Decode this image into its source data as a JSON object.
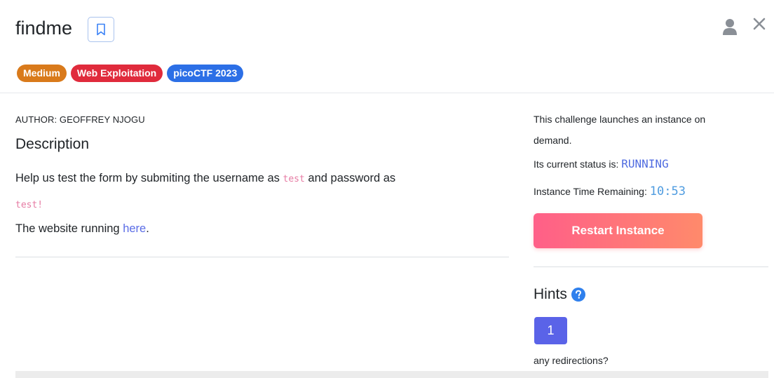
{
  "challenge": {
    "title": "findme",
    "tags": [
      "Medium",
      "Web Exploitation",
      "picoCTF 2023"
    ],
    "author": "AUTHOR: GEOFFREY NJOGU",
    "description_heading": "Description",
    "description": {
      "line1_before": "Help us test the form by submiting the username as ",
      "username": "test",
      "line1_middle": " and password as",
      "password": "test!",
      "line3_before": "The website running ",
      "link_text": "here",
      "line3_after": "."
    }
  },
  "instance": {
    "launch_line1": "This challenge launches an instance on",
    "launch_line2": "demand.",
    "status_label": "Its current status is: ",
    "status_value": "RUNNING",
    "time_label": "Instance Time Remaining: ",
    "time_value": "10:53",
    "restart_label": "Restart Instance"
  },
  "hints": {
    "heading": "Hints",
    "items": [
      {
        "number": "1",
        "text": "any redirections?"
      }
    ]
  },
  "colors": {
    "medium": "#d97a1b",
    "web_exploitation": "#e02b3c",
    "event": "#2c6fe6",
    "accent": "#5a63e8"
  },
  "icons": [
    "bookmark-icon",
    "user-icon",
    "close-icon",
    "help-circle-icon"
  ]
}
